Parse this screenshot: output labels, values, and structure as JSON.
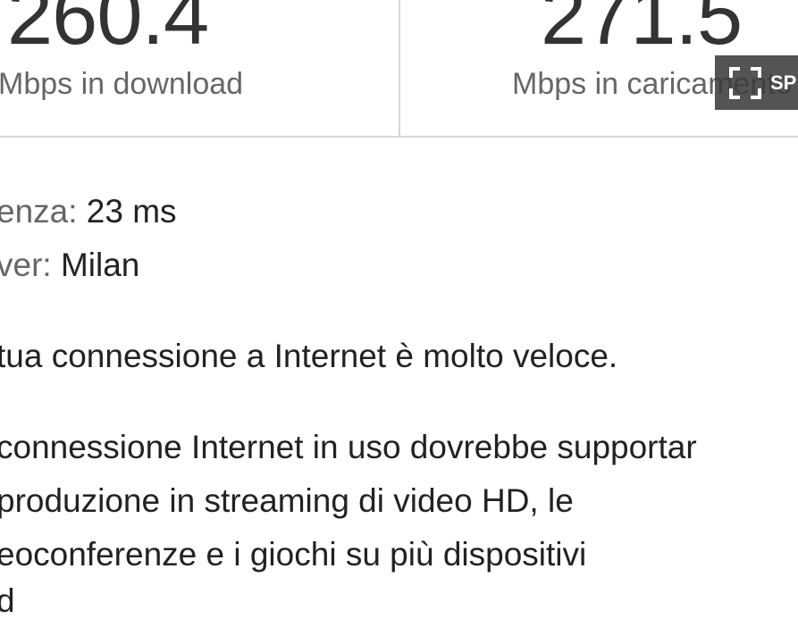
{
  "results": {
    "download": {
      "value": "260.4",
      "unit": "Mbps in download"
    },
    "upload": {
      "value": "271.5",
      "unit": "Mbps in caricamento"
    }
  },
  "overlay": {
    "icon": "fullscreen-icon",
    "label": "SP"
  },
  "details": {
    "latency_label": "enza:",
    "latency_value": "23 ms",
    "server_label": "ver:",
    "server_value": "Milan"
  },
  "summary": {
    "verdict": "tua connessione a Internet è molto veloce.",
    "lines": [
      "connessione Internet in uso dovrebbe supportar",
      "produzione in streaming di video HD, le",
      "eoconferenze e i giochi su più dispositivi",
      "d"
    ]
  },
  "colors": {
    "divider": "#d6d6d6",
    "muted_text": "#666666",
    "body_text": "#222222",
    "overlay_bg": "#3c3c3c"
  }
}
